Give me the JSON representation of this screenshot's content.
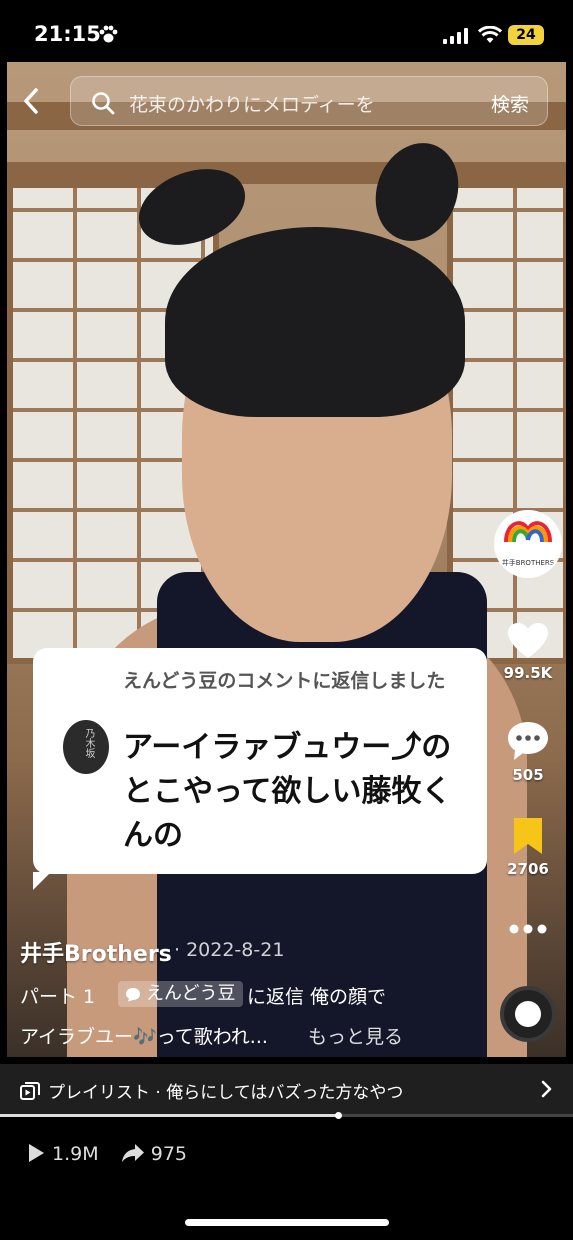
{
  "status": {
    "time": "21:15",
    "battery": "24"
  },
  "search": {
    "placeholder": "花束のかわりにメロディーを",
    "button": "検索"
  },
  "rail": {
    "avatar_caption": "井手BROTHERS",
    "likes": "99.5K",
    "comments": "505",
    "saves": "2706"
  },
  "reply_bubble": {
    "label": "えんどう豆のコメントに返信しました",
    "text": "アーイラァブュウー⤴︎のとこやって欲しい藤牧くんの",
    "commenter_avatar_text": "乃木坂"
  },
  "post": {
    "author": "井手Brothers",
    "date": "· 2022-8-21",
    "caption_prefix": "パート 1",
    "chip": "えんどう豆",
    "caption_suffix": "に返信 俺の顔で",
    "caption_line2": "アイラブユー🎶って歌われ...",
    "more": "もっと見る"
  },
  "playlist": {
    "title": "プレイリスト · 俺らにしてはバズった方なやつ"
  },
  "progress": {
    "fraction": 0.59
  },
  "stats": {
    "plays": "1.9M",
    "shares": "975"
  },
  "colors": {
    "save": "#f5c518",
    "battery": "#f2d33b"
  }
}
